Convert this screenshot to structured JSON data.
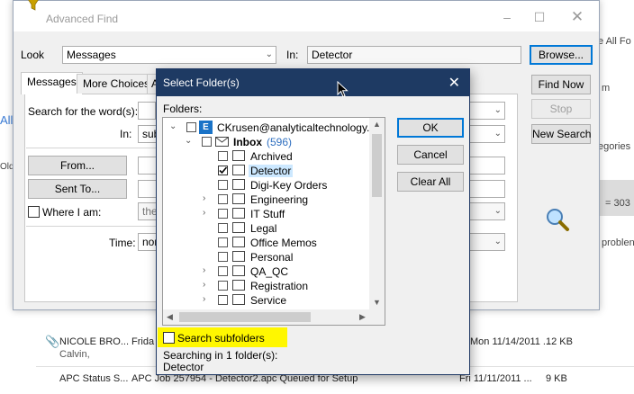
{
  "background": {
    "right_frag_all_folders": "e All Fo",
    "right_frag_m": "m",
    "right_frag_categories": "egories",
    "right_frag_number": "= 303",
    "right_frag_problem": "problen",
    "left_frag_all": "All",
    "left_frag_old": "Old",
    "rows": [
      {
        "from": "NICOLE BRO...",
        "subject": "Frida",
        "date": "Mon 11/14/2011 ...",
        "size": "12 KB",
        "preview": "Calvin,"
      },
      {
        "from": "APC Status S...",
        "subject": "APC Job 257954 - Detector2.apc Queued for Setup",
        "date": "Fri 11/11/2011 ...",
        "size": "9 KB"
      }
    ]
  },
  "advanced_find": {
    "title": "Advanced Find",
    "look_label": "Look",
    "look_value": "Messages",
    "in_label": "In:",
    "in_value": "Detector",
    "browse_label": "Browse...",
    "find_now_label": "Find Now",
    "stop_label": "Stop",
    "new_search_label": "New Search",
    "tabs": [
      "Messages",
      "More Choices",
      "A"
    ],
    "search_words_label": "Search for the word(s):",
    "in2_label": "In:",
    "in2_value": "subj",
    "from_label": "From...",
    "sent_to_label": "Sent To...",
    "where_label": "Where I am:",
    "where_value": "the",
    "time_label": "Time:",
    "time_value": "non"
  },
  "select_folder": {
    "title": "Select Folder(s)",
    "folders_label": "Folders:",
    "account": "CKrusen@analyticaltechnology.cc",
    "inbox_label": "Inbox",
    "inbox_count": "(596)",
    "items": [
      {
        "label": "Archived",
        "checked": false,
        "expandable": false
      },
      {
        "label": "Detector",
        "checked": true,
        "expandable": false,
        "selected": true
      },
      {
        "label": "Digi-Key Orders",
        "checked": false,
        "expandable": false
      },
      {
        "label": "Engineering",
        "checked": false,
        "expandable": true
      },
      {
        "label": "IT Stuff",
        "checked": false,
        "expandable": true
      },
      {
        "label": "Legal",
        "checked": false,
        "expandable": false
      },
      {
        "label": "Office Memos",
        "checked": false,
        "expandable": false
      },
      {
        "label": "Personal",
        "checked": false,
        "expandable": false
      },
      {
        "label": "QA_QC",
        "checked": false,
        "expandable": true
      },
      {
        "label": "Registration",
        "checked": false,
        "expandable": true
      },
      {
        "label": "Service",
        "checked": false,
        "expandable": true
      }
    ],
    "ok_label": "OK",
    "cancel_label": "Cancel",
    "clear_all_label": "Clear All",
    "search_subfolders_label": "Search subfolders",
    "search_subfolders_checked": false,
    "searching_label": "Searching in 1 folder(s):",
    "searching_value": "Detector"
  },
  "colors": {
    "dialog_title_bg": "#1e3a63",
    "highlight": "#fff700",
    "selection": "#cce8ff",
    "account_icon": "#1a73c7",
    "inbox_count": "#3070c0"
  }
}
